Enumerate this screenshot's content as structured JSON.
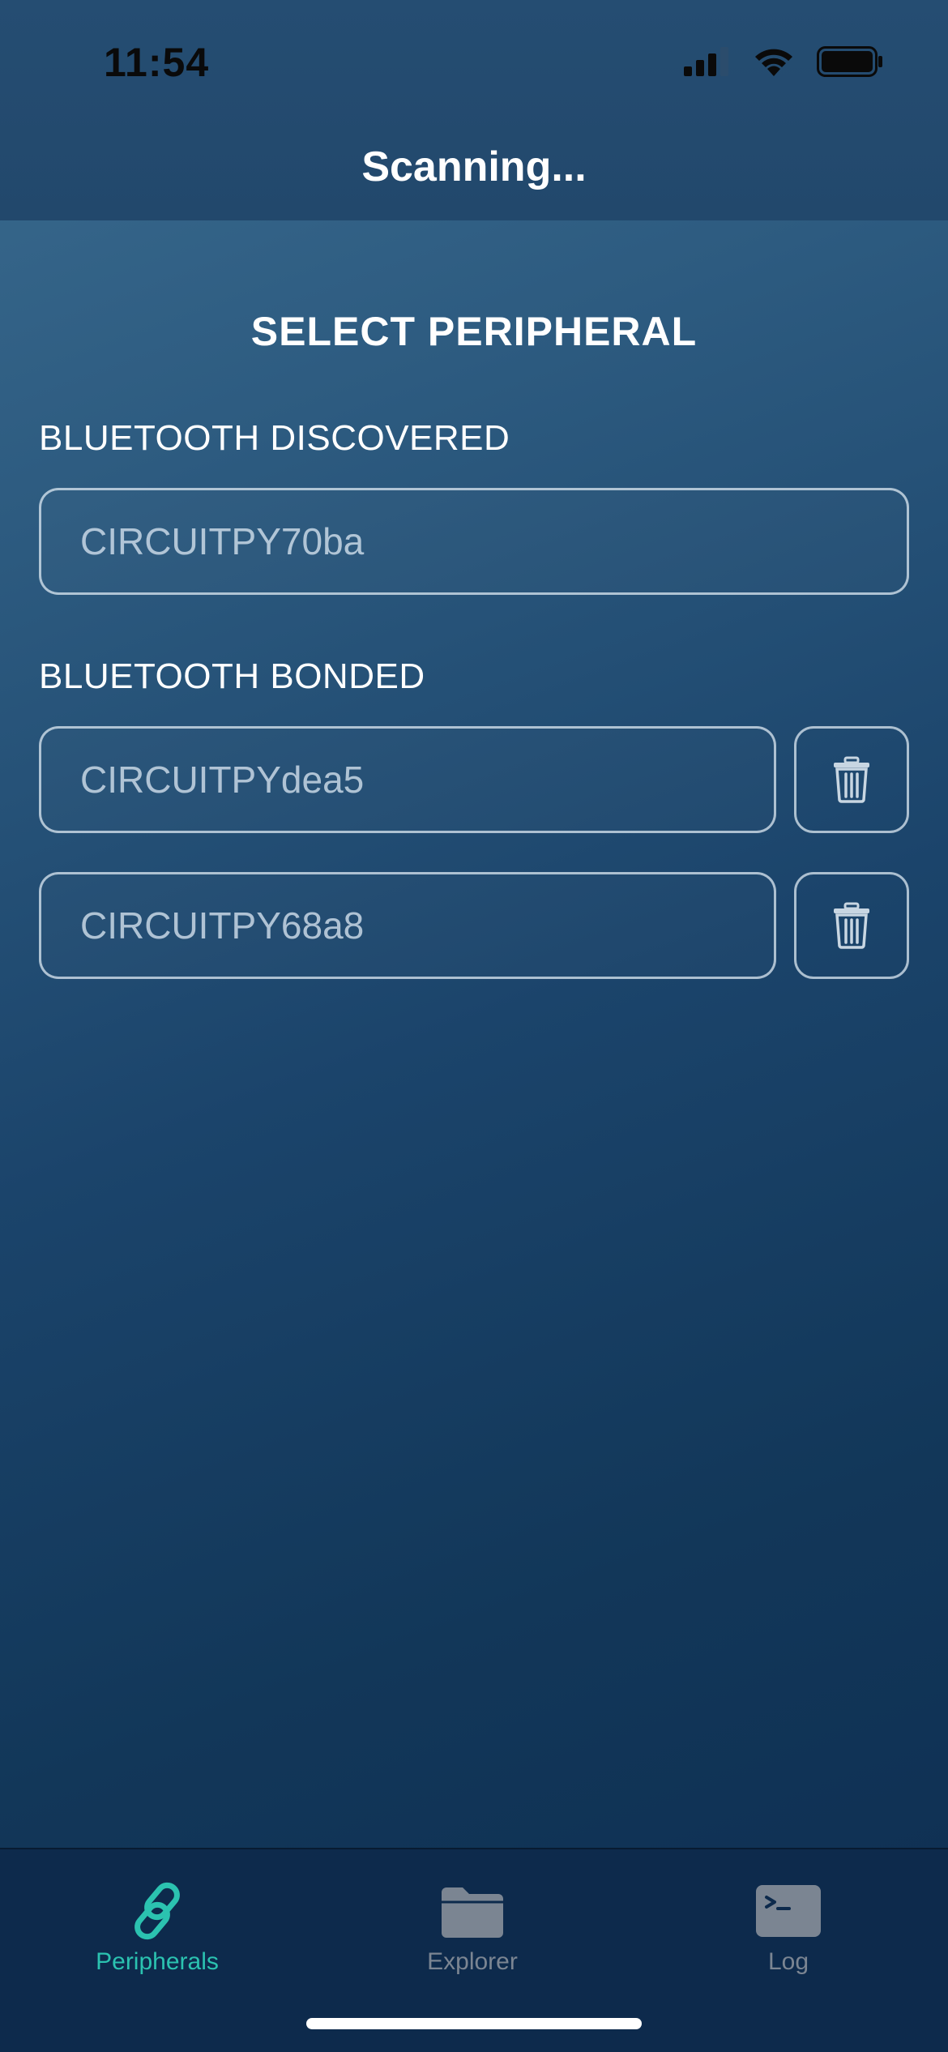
{
  "status_bar": {
    "time": "11:54"
  },
  "header": {
    "title": "Scanning..."
  },
  "main": {
    "section_title": "SELECT PERIPHERAL",
    "discovered": {
      "label": "BLUETOOTH DISCOVERED",
      "devices": [
        "CIRCUITPY70ba"
      ]
    },
    "bonded": {
      "label": "BLUETOOTH BONDED",
      "devices": [
        "CIRCUITPYdea5",
        "CIRCUITPY68a8"
      ]
    }
  },
  "tabbar": {
    "tabs": [
      {
        "label": "Peripherals",
        "icon": "link-icon",
        "active": true
      },
      {
        "label": "Explorer",
        "icon": "folder-icon",
        "active": false
      },
      {
        "label": "Log",
        "icon": "terminal-icon",
        "active": false
      }
    ]
  },
  "colors": {
    "accent": "#2bc2b0",
    "inactive_tab": "#7b8592",
    "background_top": "#3a6b8f",
    "background_bottom": "#0e2e52"
  }
}
